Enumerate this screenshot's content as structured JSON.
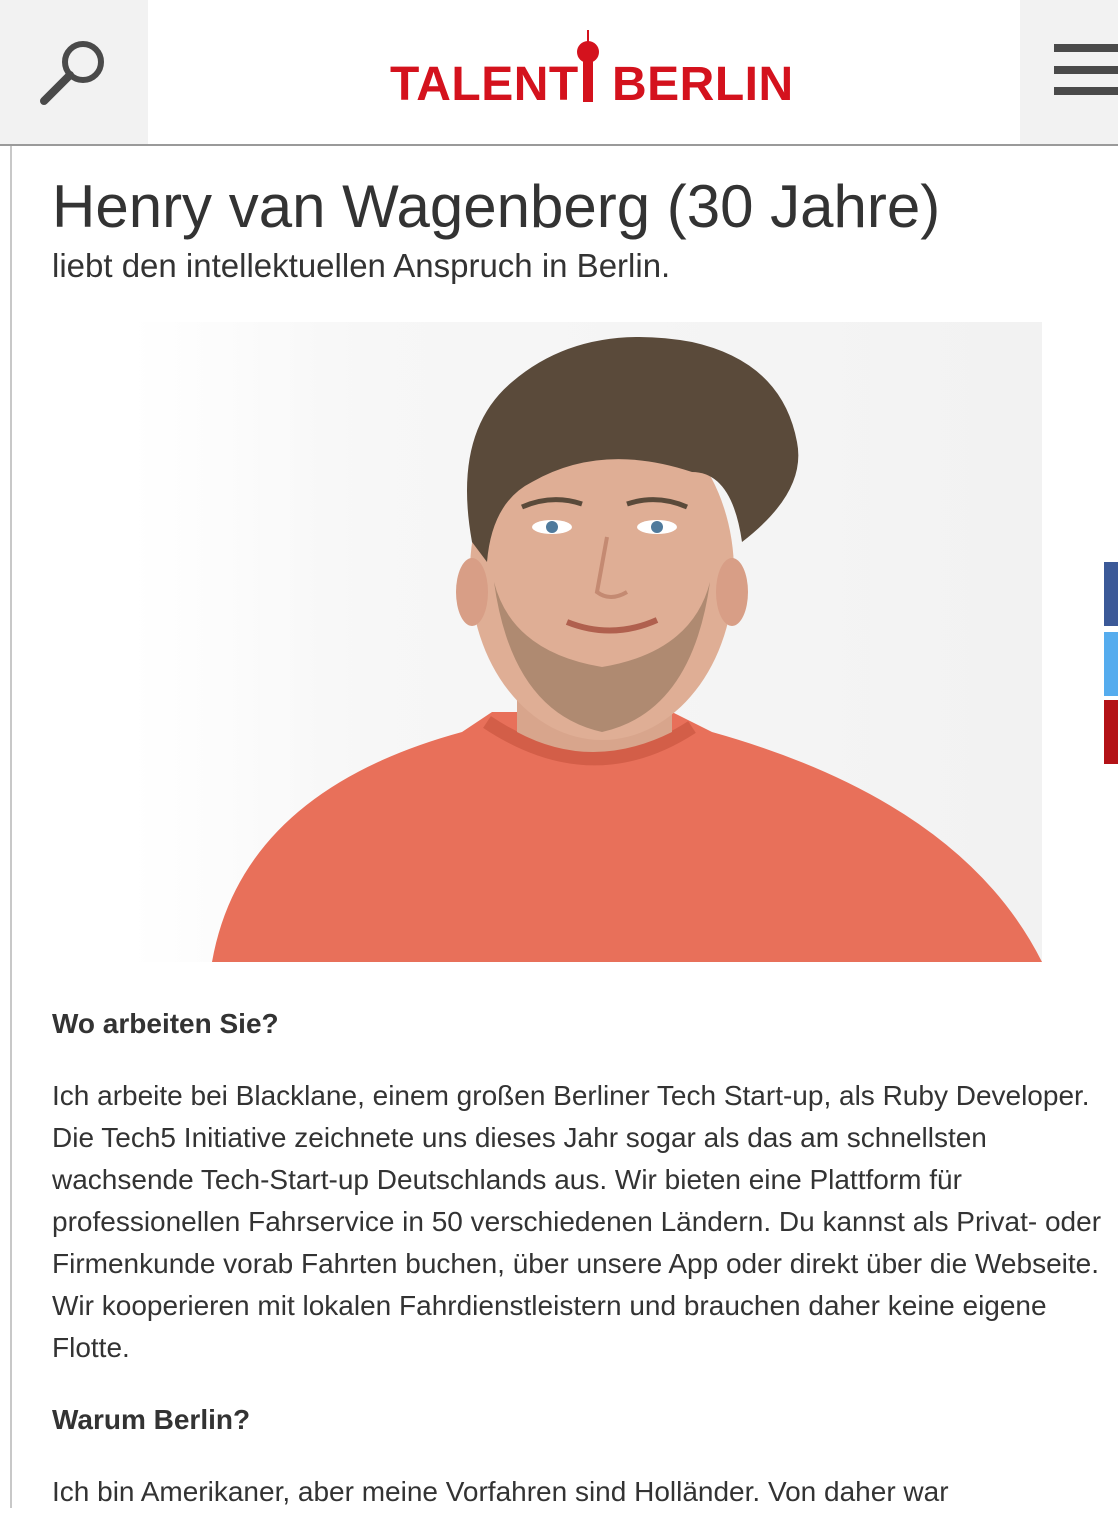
{
  "header": {
    "logo_left": "TALENT",
    "logo_right": "BERLIN",
    "search_icon": "search-icon",
    "menu_icon": "hamburger-menu-icon",
    "brand_color": "#d4121d"
  },
  "article": {
    "title": "Henry van Wagenberg (30 Jahre)",
    "subtitle": "liebt den intellektuellen Anspruch in Berlin.",
    "q1": "Wo arbeiten Sie?",
    "a1": "Ich arbeite bei Blacklane, einem großen Berliner Tech Start-up, als Ruby Developer. Die Tech5 Initiative zeichnete uns dieses Jahr sogar als das am schnellsten wachsende Tech-Start-up Deutschlands aus. Wir bieten eine Plattform für professionellen Fahrservice in 50 verschiedenen Ländern. Du kannst als Privat- oder Firmenkunde vorab Fahrten buchen, über unsere App oder direkt über die Webseite. Wir kooperieren mit lokalen Fahrdienstleistern und brauchen daher keine eigene Flotte.",
    "q2": "Warum Berlin?",
    "a2": "Ich bin Amerikaner, aber meine Vorfahren sind Holländer. Von daher war"
  },
  "share": {
    "facebook_color": "#3b5998",
    "twitter_color": "#55acee",
    "pinterest_color": "#b31217"
  }
}
